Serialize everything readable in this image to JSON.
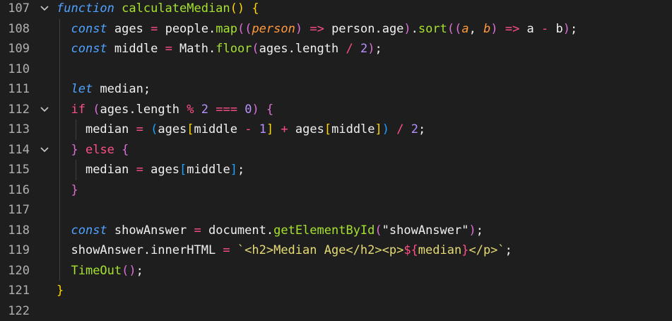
{
  "colors": {
    "background": "#1e1e1e",
    "line_number": "#b0b0b0",
    "keyword": "#4fa3ff",
    "function": "#a6e22e",
    "operator": "#ff4f86",
    "bracket_gold": "#ffd700",
    "bracket_orchid": "#da70d6",
    "bracket_blue": "#1fa2ff",
    "parameter": "#ff9a3c",
    "number": "#b892ff",
    "string": "#e6db74"
  },
  "lines": [
    {
      "num": "107",
      "fold": true,
      "indent": 0,
      "tokens": [
        {
          "t": "kw",
          "v": "function "
        },
        {
          "t": "fn",
          "v": "calculateMedian"
        },
        {
          "t": "b1",
          "v": "() {"
        }
      ]
    },
    {
      "num": "108",
      "fold": false,
      "indent": 1,
      "tokens": [
        {
          "t": "kw",
          "v": "const "
        },
        {
          "t": "pl",
          "v": "ages "
        },
        {
          "t": "op",
          "v": "= "
        },
        {
          "t": "pl",
          "v": "people."
        },
        {
          "t": "fn",
          "v": "map"
        },
        {
          "t": "b2",
          "v": "(("
        },
        {
          "t": "pr",
          "v": "person"
        },
        {
          "t": "b2",
          "v": ") "
        },
        {
          "t": "op",
          "v": "=> "
        },
        {
          "t": "pl",
          "v": "person.age"
        },
        {
          "t": "b2",
          "v": ")"
        },
        {
          "t": "pl",
          "v": "."
        },
        {
          "t": "fn",
          "v": "sort"
        },
        {
          "t": "b2",
          "v": "(("
        },
        {
          "t": "pr",
          "v": "a"
        },
        {
          "t": "pl",
          "v": ", "
        },
        {
          "t": "pr",
          "v": "b"
        },
        {
          "t": "b2",
          "v": ") "
        },
        {
          "t": "op",
          "v": "=> "
        },
        {
          "t": "pl",
          "v": "a "
        },
        {
          "t": "op",
          "v": "- "
        },
        {
          "t": "pl",
          "v": "b"
        },
        {
          "t": "b2",
          "v": ")"
        },
        {
          "t": "pl",
          "v": ";"
        }
      ]
    },
    {
      "num": "109",
      "fold": false,
      "indent": 1,
      "tokens": [
        {
          "t": "kw",
          "v": "const "
        },
        {
          "t": "pl",
          "v": "middle "
        },
        {
          "t": "op",
          "v": "= "
        },
        {
          "t": "pl",
          "v": "Math."
        },
        {
          "t": "fn",
          "v": "floor"
        },
        {
          "t": "b2",
          "v": "("
        },
        {
          "t": "pl",
          "v": "ages.length "
        },
        {
          "t": "op",
          "v": "/ "
        },
        {
          "t": "num",
          "v": "2"
        },
        {
          "t": "b2",
          "v": ")"
        },
        {
          "t": "pl",
          "v": ";"
        }
      ]
    },
    {
      "num": "110",
      "fold": false,
      "indent": 1,
      "tokens": []
    },
    {
      "num": "111",
      "fold": false,
      "indent": 1,
      "tokens": [
        {
          "t": "kw",
          "v": "let "
        },
        {
          "t": "pl",
          "v": "median;"
        }
      ]
    },
    {
      "num": "112",
      "fold": true,
      "indent": 1,
      "tokens": [
        {
          "t": "ctl",
          "v": "if "
        },
        {
          "t": "b2",
          "v": "("
        },
        {
          "t": "pl",
          "v": "ages.length "
        },
        {
          "t": "op",
          "v": "% "
        },
        {
          "t": "num",
          "v": "2 "
        },
        {
          "t": "op",
          "v": "=== "
        },
        {
          "t": "num",
          "v": "0"
        },
        {
          "t": "b2",
          "v": ") {"
        }
      ]
    },
    {
      "num": "113",
      "fold": false,
      "indent": 2,
      "tokens": [
        {
          "t": "pl",
          "v": "median "
        },
        {
          "t": "op",
          "v": "= "
        },
        {
          "t": "b3",
          "v": "("
        },
        {
          "t": "pl",
          "v": "ages"
        },
        {
          "t": "b1",
          "v": "["
        },
        {
          "t": "pl",
          "v": "middle "
        },
        {
          "t": "op",
          "v": "- "
        },
        {
          "t": "num",
          "v": "1"
        },
        {
          "t": "b1",
          "v": "] "
        },
        {
          "t": "op",
          "v": "+ "
        },
        {
          "t": "pl",
          "v": "ages"
        },
        {
          "t": "b1",
          "v": "["
        },
        {
          "t": "pl",
          "v": "middle"
        },
        {
          "t": "b1",
          "v": "]"
        },
        {
          "t": "b3",
          "v": ") "
        },
        {
          "t": "op",
          "v": "/ "
        },
        {
          "t": "num",
          "v": "2"
        },
        {
          "t": "pl",
          "v": ";"
        }
      ]
    },
    {
      "num": "114",
      "fold": true,
      "indent": 1,
      "tokens": [
        {
          "t": "b2",
          "v": "} "
        },
        {
          "t": "ctl",
          "v": "else "
        },
        {
          "t": "b2",
          "v": "{"
        }
      ]
    },
    {
      "num": "115",
      "fold": false,
      "indent": 2,
      "tokens": [
        {
          "t": "pl",
          "v": "median "
        },
        {
          "t": "op",
          "v": "= "
        },
        {
          "t": "pl",
          "v": "ages"
        },
        {
          "t": "b3",
          "v": "["
        },
        {
          "t": "pl",
          "v": "middle"
        },
        {
          "t": "b3",
          "v": "]"
        },
        {
          "t": "pl",
          "v": ";"
        }
      ]
    },
    {
      "num": "116",
      "fold": false,
      "indent": 1,
      "tokens": [
        {
          "t": "b2",
          "v": "}"
        }
      ]
    },
    {
      "num": "117",
      "fold": false,
      "indent": 1,
      "tokens": []
    },
    {
      "num": "118",
      "fold": false,
      "indent": 1,
      "tokens": [
        {
          "t": "kw",
          "v": "const "
        },
        {
          "t": "pl",
          "v": "showAnswer "
        },
        {
          "t": "op",
          "v": "= "
        },
        {
          "t": "pl",
          "v": "document."
        },
        {
          "t": "fn",
          "v": "getElementById"
        },
        {
          "t": "b2",
          "v": "("
        },
        {
          "t": "pl",
          "v": "\"showAnswer\""
        },
        {
          "t": "b2",
          "v": ")"
        },
        {
          "t": "pl",
          "v": ";"
        }
      ]
    },
    {
      "num": "119",
      "fold": false,
      "indent": 1,
      "tokens": [
        {
          "t": "pl",
          "v": "showAnswer.innerHTML "
        },
        {
          "t": "op",
          "v": "= "
        },
        {
          "t": "str",
          "v": "`<h2>Median Age</h2><p>"
        },
        {
          "t": "op",
          "v": "${"
        },
        {
          "t": "str",
          "v": "median"
        },
        {
          "t": "op",
          "v": "}"
        },
        {
          "t": "str",
          "v": "</p>`"
        },
        {
          "t": "pl",
          "v": ";"
        }
      ]
    },
    {
      "num": "120",
      "fold": false,
      "indent": 1,
      "tokens": [
        {
          "t": "fn",
          "v": "TimeOut"
        },
        {
          "t": "b2",
          "v": "()"
        },
        {
          "t": "pl",
          "v": ";"
        }
      ]
    },
    {
      "num": "121",
      "fold": false,
      "indent": 0,
      "tokens": [
        {
          "t": "b1",
          "v": "}"
        }
      ]
    },
    {
      "num": "122",
      "fold": false,
      "indent": 0,
      "tokens": []
    }
  ]
}
